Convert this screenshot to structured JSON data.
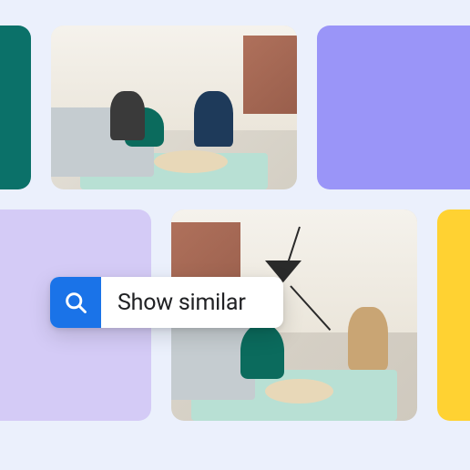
{
  "search": {
    "label": "Show similar"
  },
  "tiles": {
    "teal": "#0B7169",
    "purple": "#9A95F8",
    "lilac": "#D4CBF6",
    "yellow": "#FFD232"
  }
}
